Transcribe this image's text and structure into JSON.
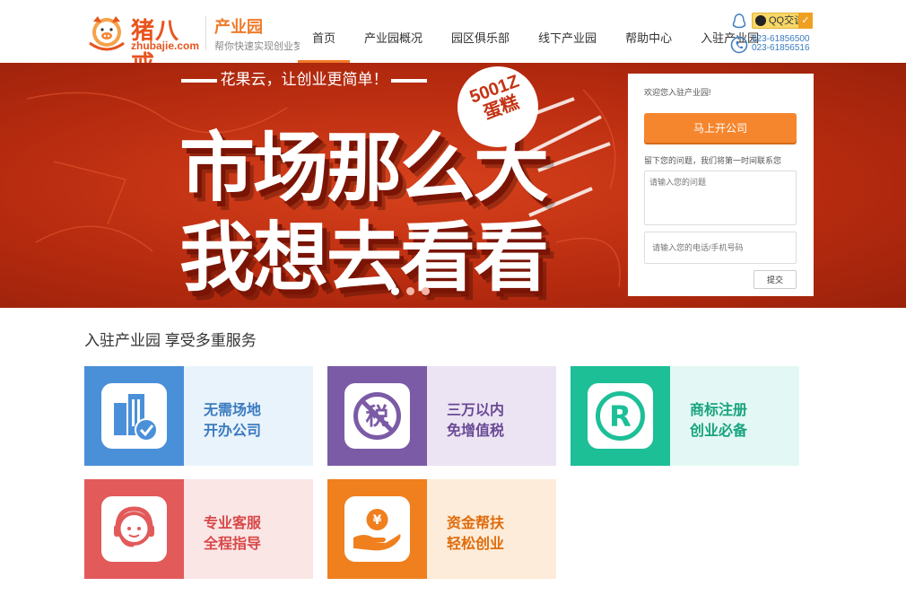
{
  "header": {
    "logo_cn": "猪八戒",
    "logo_en": "zhubajie.com",
    "park_title": "产业园",
    "park_subtitle": "帮你快速实现创业梦",
    "nav": [
      "首页",
      "产业园概况",
      "园区俱乐部",
      "线下产业园",
      "帮助中心",
      "入驻产业园"
    ],
    "active_nav": "首页",
    "qq_label": "QQ交谈",
    "phone1": "023-61856500",
    "phone2": "023-61856516"
  },
  "banner": {
    "slogan": "花果云，让创业更简单！",
    "line1": "市场那么大",
    "line2": "我想去看看",
    "badge": "5001Z 蛋糕",
    "slide_count": 3,
    "active_slide": 1
  },
  "form": {
    "welcome": "欢迎您入驻产业园!",
    "open_button": "马上开公司",
    "hint": "留下您的问题，我们将第一时间联系您",
    "question_placeholder": "请输入您的问题",
    "phone_placeholder": "请输入您的电话/手机号码",
    "submit": "提交"
  },
  "services": {
    "title": "入驻产业园 享受多重服务",
    "cards": [
      {
        "line1": "无需场地",
        "line2": "开办公司",
        "icon": "building-check-icon",
        "color": "#4a90d9",
        "bg": "#e9f3fc",
        "text_color": "#3a7bbf"
      },
      {
        "line1": "三万以内",
        "line2": "免增值税",
        "icon": "no-tax-icon",
        "color": "#7b5ba6",
        "bg": "#ece4f3",
        "text_color": "#6a4a96"
      },
      {
        "line1": "商标注册",
        "line2": "创业必备",
        "icon": "trademark-icon",
        "color": "#1dbf97",
        "bg": "#e3f8f4",
        "text_color": "#18a37f"
      },
      {
        "line1": "专业客服",
        "line2": "全程指导",
        "icon": "headset-agent-icon",
        "color": "#e25a5a",
        "bg": "#fbe6e6",
        "text_color": "#d84848"
      },
      {
        "line1": "资金帮扶",
        "line2": "轻松创业",
        "icon": "money-hand-icon",
        "color": "#f07f1e",
        "bg": "#fdecd9",
        "text_color": "#e06c0c"
      }
    ]
  }
}
